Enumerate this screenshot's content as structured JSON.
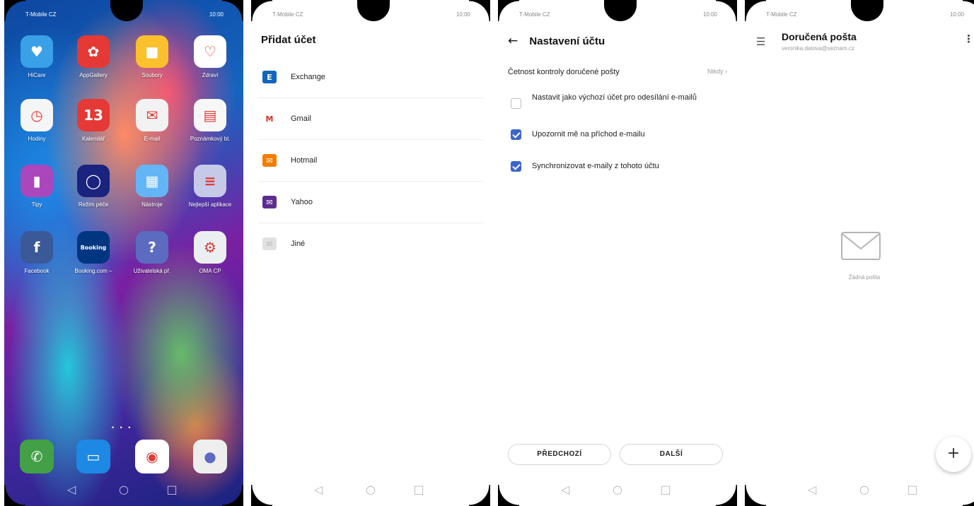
{
  "status": {
    "carrier": "T-Mobile CZ",
    "time": "10:00"
  },
  "screen1": {
    "apps": [
      {
        "label": "HiCare",
        "color": "#3aa0e8"
      },
      {
        "label": "AppGallery",
        "color": "#e53935"
      },
      {
        "label": "Soubory",
        "color": "#fbc02d"
      },
      {
        "label": "Zdraví",
        "color": "#ffffff"
      },
      {
        "label": "Hodiny",
        "color": "#f5f5f5"
      },
      {
        "label": "Kalendář",
        "color": "#e53935",
        "day": "13"
      },
      {
        "label": "E-mail",
        "color": "#f2f2f2"
      },
      {
        "label": "Poznámkový bl.",
        "color": "#f7f7f7"
      },
      {
        "label": "Tipy",
        "color": "#ab47bc"
      },
      {
        "label": "Režim péče",
        "color": "#1a237e"
      },
      {
        "label": "Nástroje",
        "color": "#64b5f6"
      },
      {
        "label": "Nejlepší aplikace",
        "color": "#c5cae9"
      },
      {
        "label": "Facebook",
        "color": "#3b5998"
      },
      {
        "label": "Booking.com –",
        "color": "#003580",
        "text": "Booking"
      },
      {
        "label": "Uživatelská př.",
        "color": "#5c6bc0"
      },
      {
        "label": "OMA CP",
        "color": "#eceff1"
      }
    ],
    "dock": [
      {
        "name": "phone",
        "color": "#43a047"
      },
      {
        "name": "messages",
        "color": "#1e88e5"
      },
      {
        "name": "chrome",
        "color": "#ffffff"
      },
      {
        "name": "camera",
        "color": "#eeeeee"
      }
    ]
  },
  "screen2": {
    "title": "Přidat účet",
    "accounts": [
      {
        "label": "Exchange",
        "icon": "exchange-icon",
        "color": "#1565c0"
      },
      {
        "label": "Gmail",
        "icon": "gmail-icon",
        "color": "#ffffff"
      },
      {
        "label": "Hotmail",
        "icon": "hotmail-icon",
        "color": "#f57c00"
      },
      {
        "label": "Yahoo",
        "icon": "yahoo-icon",
        "color": "#5c2d91"
      },
      {
        "label": "Jiné",
        "icon": "other-mail-icon",
        "color": "#e0e0e0"
      }
    ]
  },
  "screen3": {
    "title": "Nastavení účtu",
    "frequency_label": "Četnost kontroly doručené pošty",
    "frequency_value": "Nikdy",
    "options": [
      {
        "label": "Nastavit jako výchozí účet pro odesílání e-mailů",
        "checked": false
      },
      {
        "label": "Upozornit mě na příchod e-mailu",
        "checked": true
      },
      {
        "label": "Synchronizovat e-maily z tohoto účtu",
        "checked": true
      }
    ],
    "prev_label": "PŘEDCHOZÍ",
    "next_label": "DALŠÍ"
  },
  "screen4": {
    "title": "Doručená pošta",
    "account": "veronika.datova@seznam.cz",
    "empty_text": "Žádná pošta"
  }
}
